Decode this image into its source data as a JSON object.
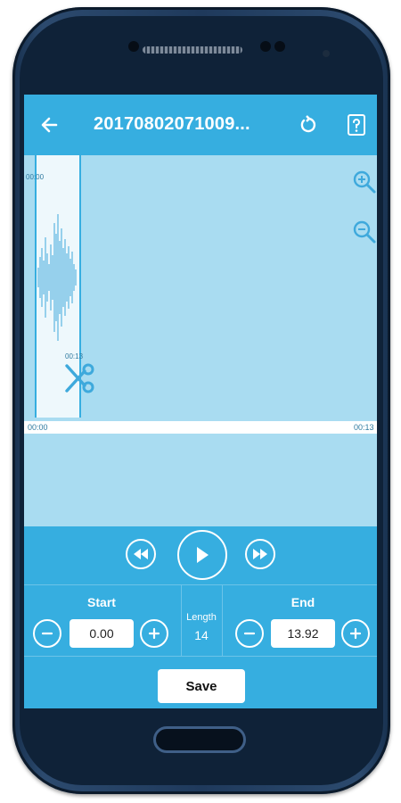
{
  "header": {
    "title": "20170802071009...",
    "back_icon": "back-arrow-icon",
    "reset_icon": "reset-icon",
    "help_icon": "help-icon"
  },
  "waveform": {
    "sel_start_time": "00:00",
    "sel_end_time": "00:13",
    "timeline_start": "00:00",
    "timeline_end": "00:13"
  },
  "zoom": {
    "in_icon": "zoom-in-icon",
    "out_icon": "zoom-out-icon"
  },
  "playback": {
    "rewind_icon": "rewind-icon",
    "play_icon": "play-icon",
    "forward_icon": "fast-forward-icon"
  },
  "start": {
    "label": "Start",
    "value": "0.00"
  },
  "length": {
    "label": "Length",
    "value": "14"
  },
  "end": {
    "label": "End",
    "value": "13.92"
  },
  "save_label": "Save",
  "colors": {
    "accent": "#36aee0",
    "waveform_bg": "#a9dcf1",
    "selection_bg": "#eef8fc"
  }
}
